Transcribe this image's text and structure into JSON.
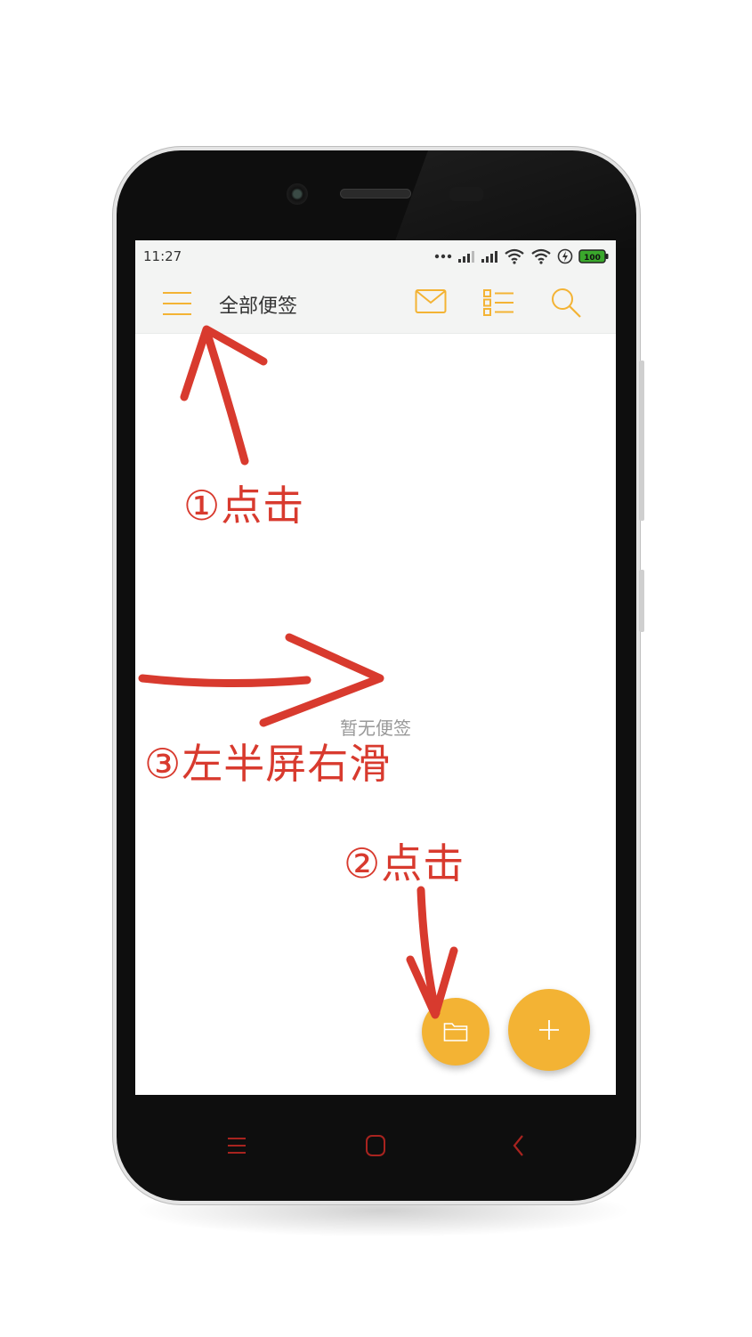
{
  "status_bar": {
    "time": "11:27",
    "battery": "100",
    "icons": [
      "dots-icon",
      "signal-icon",
      "signal-icon",
      "wifi-icon",
      "wifi-icon",
      "charging-icon",
      "battery-icon"
    ]
  },
  "app_bar": {
    "title": "全部便签",
    "icons": [
      "menu-icon",
      "mail-icon",
      "list-icon",
      "search-icon"
    ]
  },
  "main": {
    "empty_text": "暂无便签"
  },
  "fab": {
    "folder_icon": "folder-icon",
    "add_icon": "plus-icon"
  },
  "navigation": {
    "icons": [
      "menu-icon",
      "home-icon",
      "back-icon"
    ]
  },
  "annotations": {
    "step1": "①点击",
    "step2": "②点击",
    "step3": "③左半屏右滑"
  },
  "colors": {
    "accent": "#f3b334",
    "annotation": "#d83a2e",
    "nav_keys": "#a8231f",
    "app_bar_bg": "#f3f4f3"
  }
}
